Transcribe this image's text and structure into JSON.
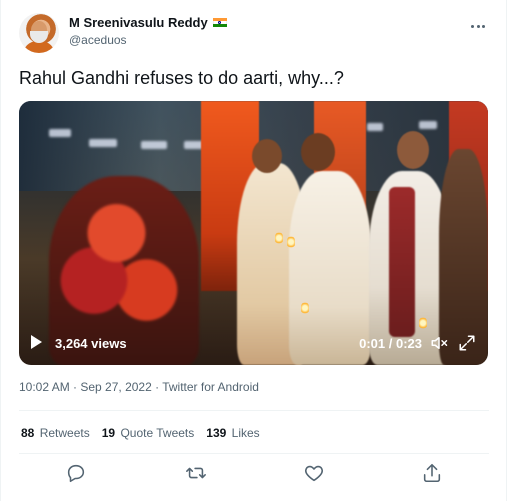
{
  "tweet": {
    "author": {
      "display_name": "M Sreenivasulu Reddy",
      "handle": "@aceduos",
      "flag_icon": "india-flag-icon"
    },
    "text": "Rahul Gandhi refuses to do aarti, why...?",
    "video": {
      "views": "3,264 views",
      "time": "0:01 / 0:23",
      "progress": 0.04
    },
    "meta": "10:02 AM · Sep 27, 2022 · Twitter for Android",
    "stats": {
      "retweets_count": "88",
      "retweets_label": "Retweets",
      "quote_count": "19",
      "quote_label": "Quote Tweets",
      "likes_count": "139",
      "likes_label": "Likes"
    },
    "actions": [
      "reply-icon",
      "retweet-icon",
      "like-icon",
      "share-icon"
    ]
  },
  "colors": {
    "text_primary": "#0f1419",
    "text_secondary": "#536471",
    "divider": "#eff3f4"
  }
}
